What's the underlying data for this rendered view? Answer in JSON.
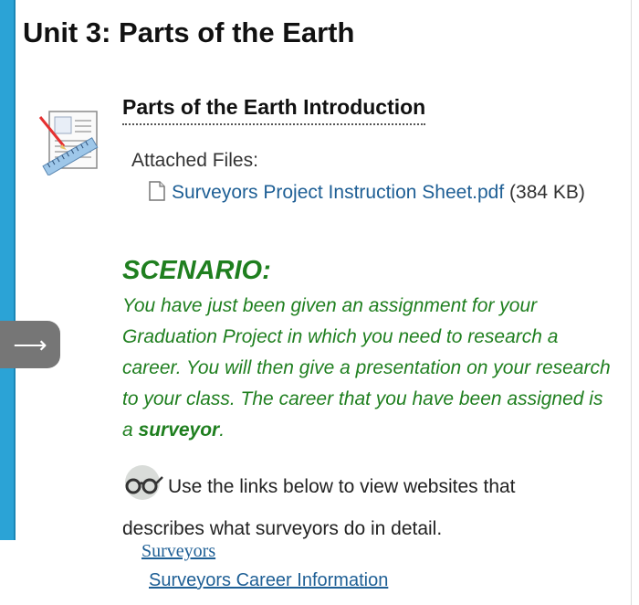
{
  "unit_title": "Unit 3: Parts of the Earth",
  "item": {
    "title": "Parts of the Earth Introduction",
    "attached_label": "Attached Files:",
    "file": {
      "name": "Surveyors Project Instruction Sheet.pdf",
      "size": "(384 KB)"
    }
  },
  "scenario": {
    "heading": "SCENARIO:",
    "text_before": "You have just been given an assignment for your Graduation Project in which you need to research a career. You will then give a presentation on your research to your class. The career that you have been assigned is a ",
    "bold_word": "surveyor",
    "text_after": "."
  },
  "links_note": "Use the links below to view websites that describes what surveyors do in detail.",
  "links": [
    "Surveyors",
    "Surveyors Career Information"
  ],
  "nav": {
    "arrow": "⟶"
  },
  "colors": {
    "accent": "#2ba3d6",
    "scenario": "#1f7f1f",
    "link": "#1e5f95"
  },
  "icons": [
    "assignment-document-icon",
    "file-icon",
    "glasses-icon",
    "arrow-right-icon"
  ]
}
